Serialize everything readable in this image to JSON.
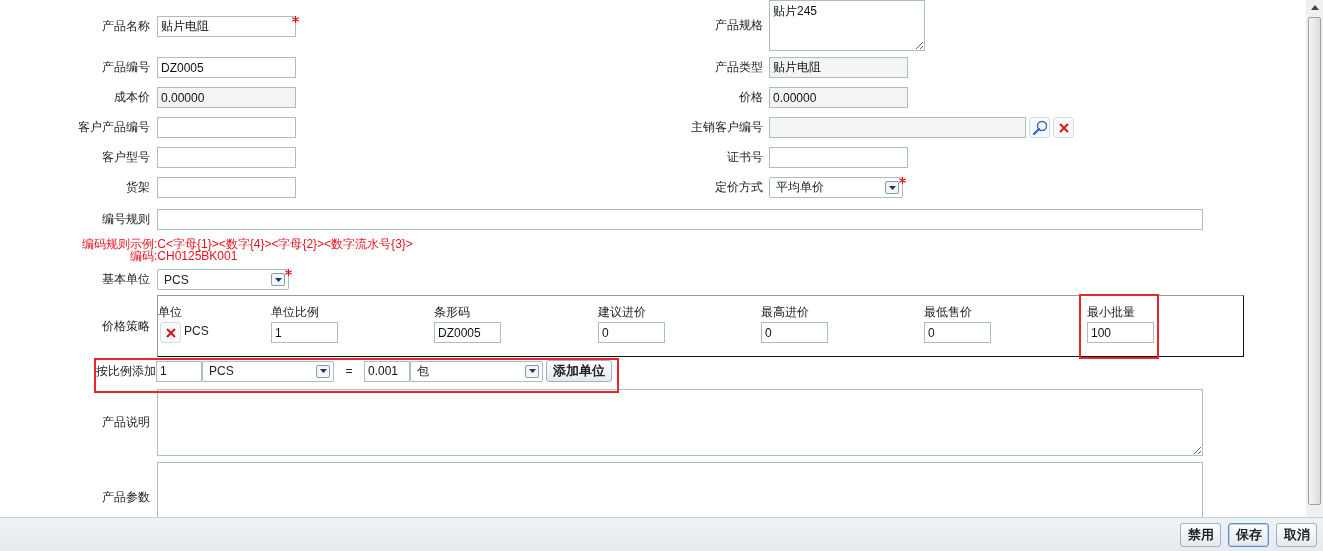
{
  "fields": [
    {
      "left": {
        "label": "产品名称",
        "kind": "text",
        "value": "贴片电阻",
        "required": true
      },
      "right": {
        "label": "产品规格",
        "kind": "textarea",
        "value": "贴片245",
        "required": false
      }
    },
    {
      "left": {
        "label": "产品编号",
        "kind": "text",
        "value": "DZ0005",
        "required": false
      },
      "right": {
        "label": "产品类型",
        "kind": "readonly",
        "value": "贴片电阻",
        "required": false
      }
    },
    {
      "left": {
        "label": "成本价",
        "kind": "readonly",
        "value": "0.00000",
        "required": false
      },
      "right": {
        "label": "价格",
        "kind": "readonly",
        "value": "0.00000",
        "required": false
      }
    },
    {
      "left": {
        "label": "客户产品编号",
        "kind": "text",
        "required": false
      },
      "right": {
        "label": "主销客户编号",
        "kind": "lookup",
        "required": false
      }
    },
    {
      "left": {
        "label": "客户型号",
        "kind": "text",
        "required": false
      },
      "right": {
        "label": "证书号",
        "kind": "text",
        "required": false
      }
    },
    {
      "left": {
        "label": "货架",
        "kind": "text",
        "required": false
      },
      "right": {
        "label": "定价方式",
        "kind": "select",
        "value": "平均单价",
        "required": true
      }
    }
  ],
  "code_rule": {
    "label": "编号规则"
  },
  "code_hints": [
    "编码规则示例:C<字母{1}><数字{4}><字母{2}><数字流水号{3}>",
    "编码:CH0125BK001"
  ],
  "base_unit": {
    "label": "基本单位",
    "value": "PCS",
    "required": true
  },
  "price_strategy": {
    "label": "价格策略",
    "columns": [
      {
        "label": "单位",
        "highlighted": false
      },
      {
        "label": "单位比例",
        "highlighted": false
      },
      {
        "label": "条形码",
        "highlighted": false
      },
      {
        "label": "建议进价",
        "highlighted": false
      },
      {
        "label": "最高进价",
        "highlighted": false
      },
      {
        "label": "最低售价",
        "highlighted": false
      },
      {
        "label": "最小批量",
        "highlighted": true
      }
    ],
    "rows": [
      {
        "cells": [
          "PCS",
          "1",
          "DZ0005",
          "0",
          "0",
          "0",
          "100"
        ]
      }
    ]
  },
  "ratio_add": {
    "label": "按比例添加",
    "highlighted": true,
    "quantity": "1",
    "from_unit": "PCS",
    "equals": "=",
    "factor": "0.001",
    "to_unit": "包",
    "button": "添加单位"
  },
  "description": {
    "label": "产品说明"
  },
  "parameters": {
    "label": "产品参数"
  },
  "footer_buttons": [
    {
      "label": "禁用",
      "focused": false
    },
    {
      "label": "保存",
      "focused": true
    },
    {
      "label": "取消",
      "focused": false
    }
  ]
}
